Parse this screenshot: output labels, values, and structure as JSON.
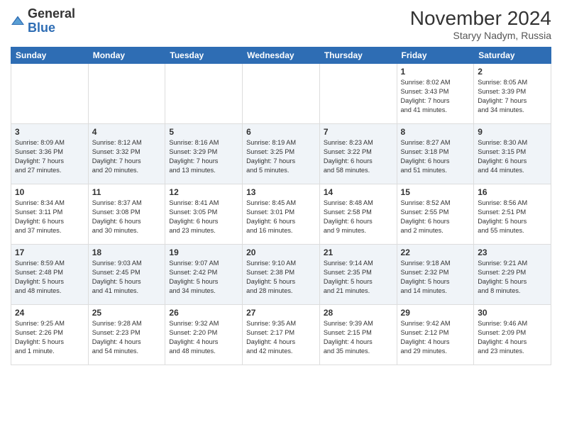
{
  "header": {
    "logo_general": "General",
    "logo_blue": "Blue",
    "month_year": "November 2024",
    "location": "Staryy Nadym, Russia"
  },
  "days_of_week": [
    "Sunday",
    "Monday",
    "Tuesday",
    "Wednesday",
    "Thursday",
    "Friday",
    "Saturday"
  ],
  "weeks": [
    [
      {
        "day": "",
        "info": ""
      },
      {
        "day": "",
        "info": ""
      },
      {
        "day": "",
        "info": ""
      },
      {
        "day": "",
        "info": ""
      },
      {
        "day": "",
        "info": ""
      },
      {
        "day": "1",
        "info": "Sunrise: 8:02 AM\nSunset: 3:43 PM\nDaylight: 7 hours\nand 41 minutes."
      },
      {
        "day": "2",
        "info": "Sunrise: 8:05 AM\nSunset: 3:39 PM\nDaylight: 7 hours\nand 34 minutes."
      }
    ],
    [
      {
        "day": "3",
        "info": "Sunrise: 8:09 AM\nSunset: 3:36 PM\nDaylight: 7 hours\nand 27 minutes."
      },
      {
        "day": "4",
        "info": "Sunrise: 8:12 AM\nSunset: 3:32 PM\nDaylight: 7 hours\nand 20 minutes."
      },
      {
        "day": "5",
        "info": "Sunrise: 8:16 AM\nSunset: 3:29 PM\nDaylight: 7 hours\nand 13 minutes."
      },
      {
        "day": "6",
        "info": "Sunrise: 8:19 AM\nSunset: 3:25 PM\nDaylight: 7 hours\nand 5 minutes."
      },
      {
        "day": "7",
        "info": "Sunrise: 8:23 AM\nSunset: 3:22 PM\nDaylight: 6 hours\nand 58 minutes."
      },
      {
        "day": "8",
        "info": "Sunrise: 8:27 AM\nSunset: 3:18 PM\nDaylight: 6 hours\nand 51 minutes."
      },
      {
        "day": "9",
        "info": "Sunrise: 8:30 AM\nSunset: 3:15 PM\nDaylight: 6 hours\nand 44 minutes."
      }
    ],
    [
      {
        "day": "10",
        "info": "Sunrise: 8:34 AM\nSunset: 3:11 PM\nDaylight: 6 hours\nand 37 minutes."
      },
      {
        "day": "11",
        "info": "Sunrise: 8:37 AM\nSunset: 3:08 PM\nDaylight: 6 hours\nand 30 minutes."
      },
      {
        "day": "12",
        "info": "Sunrise: 8:41 AM\nSunset: 3:05 PM\nDaylight: 6 hours\nand 23 minutes."
      },
      {
        "day": "13",
        "info": "Sunrise: 8:45 AM\nSunset: 3:01 PM\nDaylight: 6 hours\nand 16 minutes."
      },
      {
        "day": "14",
        "info": "Sunrise: 8:48 AM\nSunset: 2:58 PM\nDaylight: 6 hours\nand 9 minutes."
      },
      {
        "day": "15",
        "info": "Sunrise: 8:52 AM\nSunset: 2:55 PM\nDaylight: 6 hours\nand 2 minutes."
      },
      {
        "day": "16",
        "info": "Sunrise: 8:56 AM\nSunset: 2:51 PM\nDaylight: 5 hours\nand 55 minutes."
      }
    ],
    [
      {
        "day": "17",
        "info": "Sunrise: 8:59 AM\nSunset: 2:48 PM\nDaylight: 5 hours\nand 48 minutes."
      },
      {
        "day": "18",
        "info": "Sunrise: 9:03 AM\nSunset: 2:45 PM\nDaylight: 5 hours\nand 41 minutes."
      },
      {
        "day": "19",
        "info": "Sunrise: 9:07 AM\nSunset: 2:42 PM\nDaylight: 5 hours\nand 34 minutes."
      },
      {
        "day": "20",
        "info": "Sunrise: 9:10 AM\nSunset: 2:38 PM\nDaylight: 5 hours\nand 28 minutes."
      },
      {
        "day": "21",
        "info": "Sunrise: 9:14 AM\nSunset: 2:35 PM\nDaylight: 5 hours\nand 21 minutes."
      },
      {
        "day": "22",
        "info": "Sunrise: 9:18 AM\nSunset: 2:32 PM\nDaylight: 5 hours\nand 14 minutes."
      },
      {
        "day": "23",
        "info": "Sunrise: 9:21 AM\nSunset: 2:29 PM\nDaylight: 5 hours\nand 8 minutes."
      }
    ],
    [
      {
        "day": "24",
        "info": "Sunrise: 9:25 AM\nSunset: 2:26 PM\nDaylight: 5 hours\nand 1 minute."
      },
      {
        "day": "25",
        "info": "Sunrise: 9:28 AM\nSunset: 2:23 PM\nDaylight: 4 hours\nand 54 minutes."
      },
      {
        "day": "26",
        "info": "Sunrise: 9:32 AM\nSunset: 2:20 PM\nDaylight: 4 hours\nand 48 minutes."
      },
      {
        "day": "27",
        "info": "Sunrise: 9:35 AM\nSunset: 2:17 PM\nDaylight: 4 hours\nand 42 minutes."
      },
      {
        "day": "28",
        "info": "Sunrise: 9:39 AM\nSunset: 2:15 PM\nDaylight: 4 hours\nand 35 minutes."
      },
      {
        "day": "29",
        "info": "Sunrise: 9:42 AM\nSunset: 2:12 PM\nDaylight: 4 hours\nand 29 minutes."
      },
      {
        "day": "30",
        "info": "Sunrise: 9:46 AM\nSunset: 2:09 PM\nDaylight: 4 hours\nand 23 minutes."
      }
    ]
  ]
}
